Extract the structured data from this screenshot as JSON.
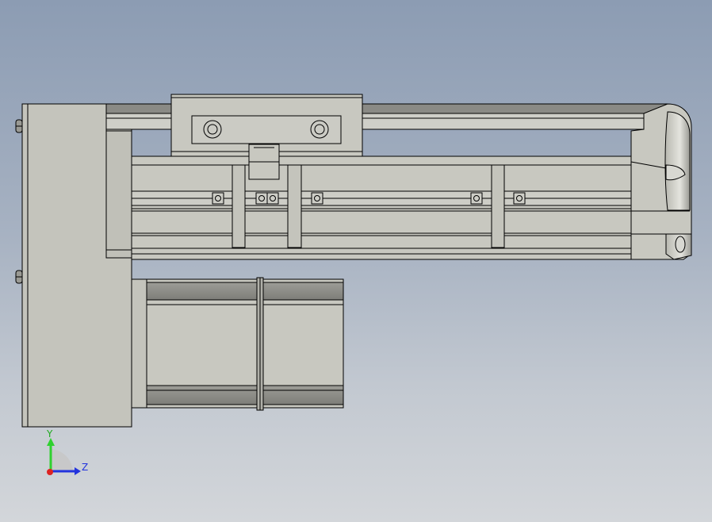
{
  "viewport": {
    "background_top": "#8c9cb3",
    "background_bottom": "#d3d6da"
  },
  "triad": {
    "y_label": "Y",
    "z_label": "Z",
    "y_color": "#2fd12f",
    "z_color": "#2233dd",
    "x_color": "#dd2222"
  },
  "model": {
    "name": "linear-actuator",
    "face_color": "#c8c8c0",
    "dark_face_color": "#8a8a85",
    "edge_color": "#000000"
  }
}
